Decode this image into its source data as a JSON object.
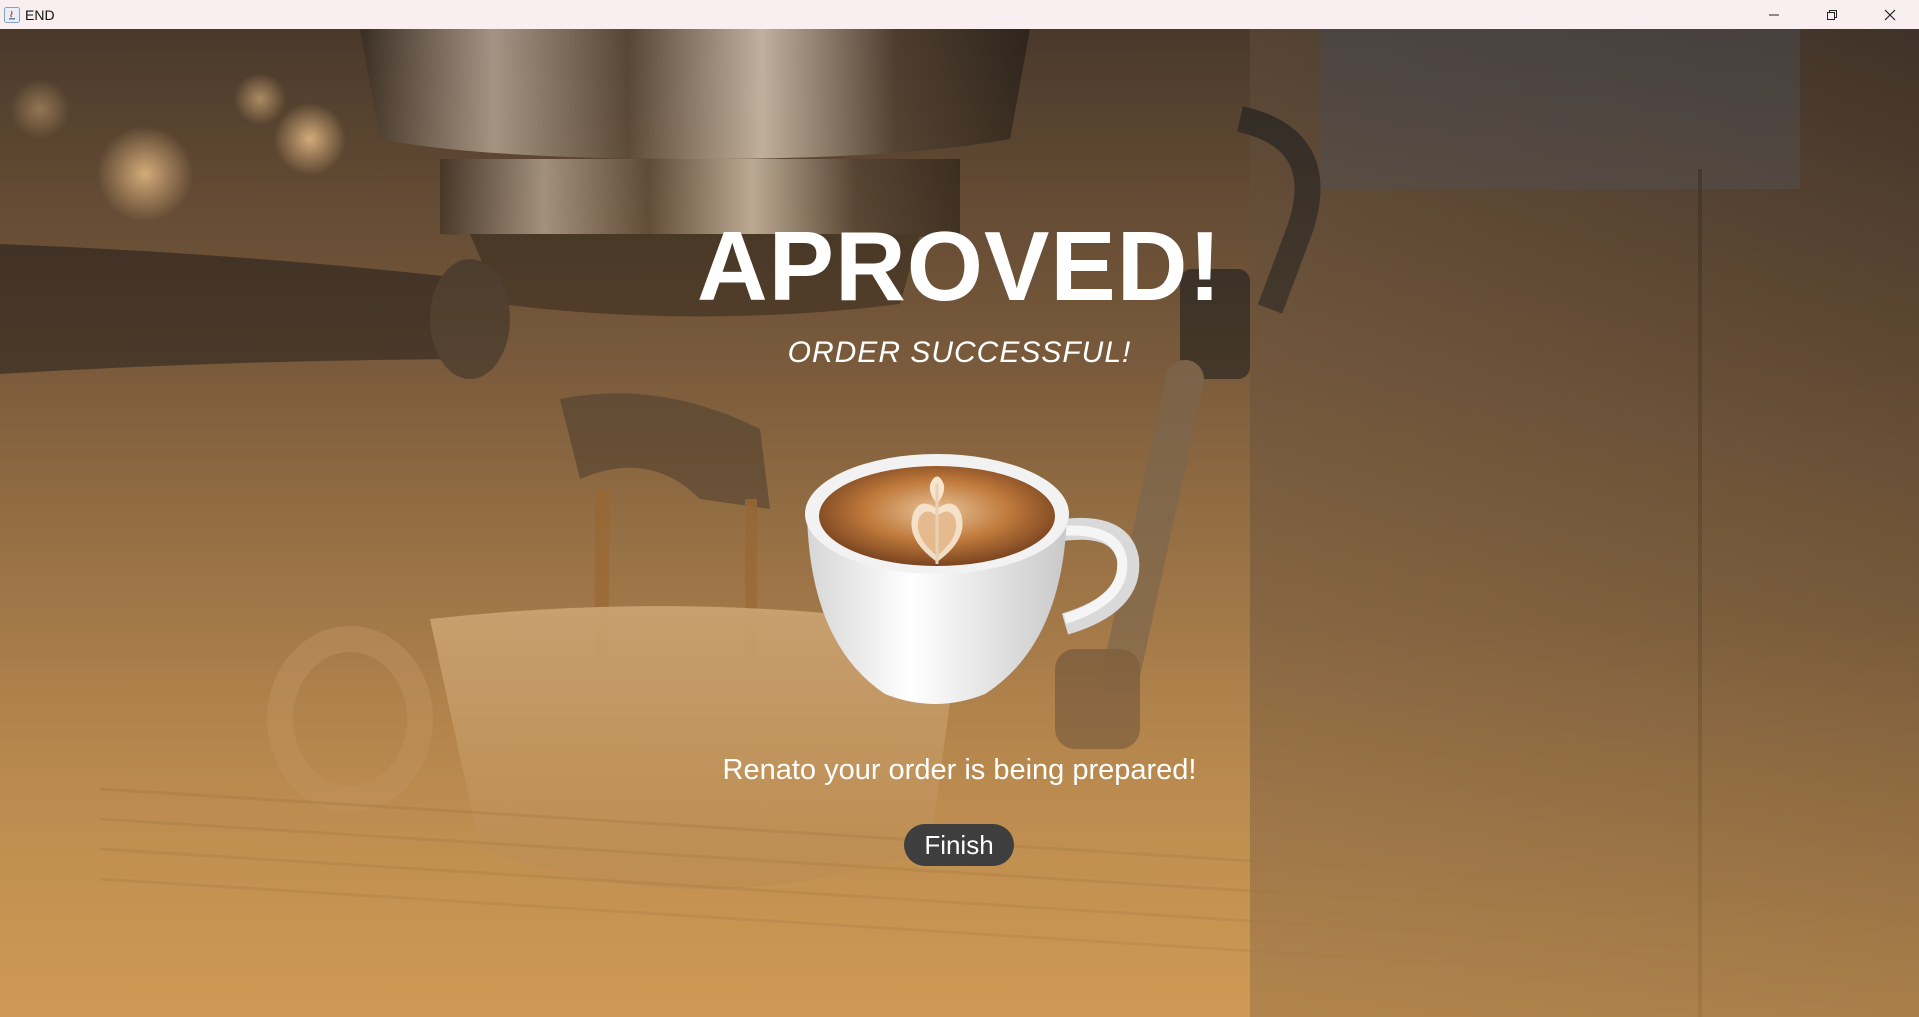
{
  "window": {
    "title": "END",
    "controls": {
      "minimize_icon": "minimize-icon",
      "maximize_icon": "restore-icon",
      "close_icon": "close-icon"
    }
  },
  "main": {
    "headline": "APROVED!",
    "subheadline": "ORDER SUCCESSFUL!",
    "message": "Renato your order is being prepared!",
    "finish_label": "Finish"
  },
  "colors": {
    "titlebar_bg": "#f9eef0",
    "text": "#ffffff",
    "button_bg": "#3e3e3e",
    "background_warm": "#c89654",
    "background_dark": "#4a3a2c"
  }
}
